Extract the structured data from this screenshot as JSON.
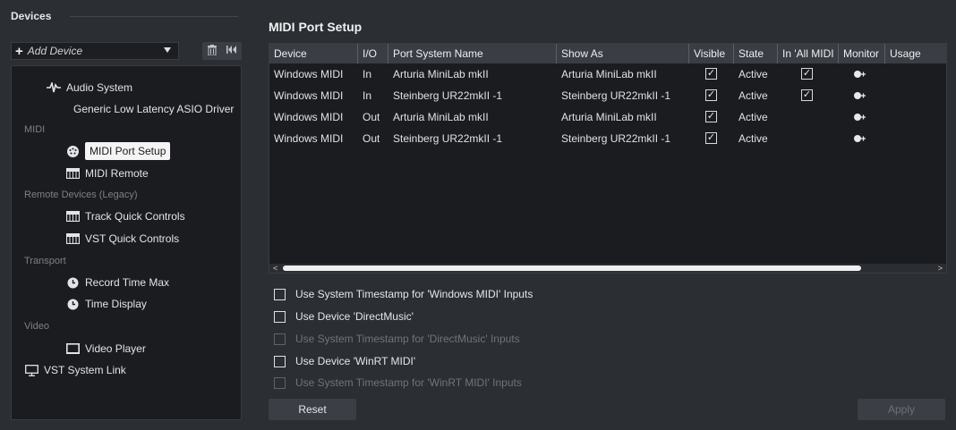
{
  "left": {
    "title": "Devices",
    "add_device_label": "Add Device",
    "tree": [
      {
        "kind": "item",
        "label": "Audio System",
        "icon": "audio-system-icon",
        "level": 1
      },
      {
        "kind": "item",
        "label": "Generic Low Latency ASIO Driver",
        "icon": "",
        "level": 2
      },
      {
        "kind": "category",
        "label": "MIDI"
      },
      {
        "kind": "item",
        "label": "MIDI Port Setup",
        "icon": "midi-port-icon",
        "level": 2,
        "selected": true
      },
      {
        "kind": "item",
        "label": "MIDI Remote",
        "icon": "keyboard-icon",
        "level": 2
      },
      {
        "kind": "category",
        "label": "Remote Devices (Legacy)"
      },
      {
        "kind": "item",
        "label": "Track Quick Controls",
        "icon": "keyboard-icon",
        "level": 2
      },
      {
        "kind": "item",
        "label": "VST Quick Controls",
        "icon": "keyboard-icon",
        "level": 2
      },
      {
        "kind": "category",
        "label": "Transport"
      },
      {
        "kind": "item",
        "label": "Record Time Max",
        "icon": "clock-icon",
        "level": 2
      },
      {
        "kind": "item",
        "label": "Time Display",
        "icon": "clock-icon",
        "level": 2
      },
      {
        "kind": "category",
        "label": "Video"
      },
      {
        "kind": "item",
        "label": "Video Player",
        "icon": "video-icon",
        "level": 2
      },
      {
        "kind": "item",
        "label": "VST System Link",
        "icon": "monitor-icon",
        "level": 0
      }
    ]
  },
  "main": {
    "title": "MIDI Port Setup",
    "columns": [
      "Device",
      "I/O",
      "Port System Name",
      "Show As",
      "Visible",
      "State",
      "In 'All MIDI Inputs'",
      "Monitor",
      "Usage"
    ],
    "rows": [
      {
        "device": "Windows MIDI",
        "io": "In",
        "port": "Arturia MiniLab mkII",
        "show_as": "Arturia MiniLab mkII",
        "visible": true,
        "state": "Active",
        "in_all": true,
        "monitor": true
      },
      {
        "device": "Windows MIDI",
        "io": "In",
        "port": "Steinberg UR22mkII -1",
        "show_as": "Steinberg UR22mkII -1",
        "visible": true,
        "state": "Active",
        "in_all": true,
        "monitor": true
      },
      {
        "device": "Windows MIDI",
        "io": "Out",
        "port": "Arturia MiniLab mkII",
        "show_as": "Arturia MiniLab mkII",
        "visible": true,
        "state": "Active",
        "in_all": false,
        "monitor": true
      },
      {
        "device": "Windows MIDI",
        "io": "Out",
        "port": "Steinberg UR22mkII -1",
        "show_as": "Steinberg UR22mkII -1",
        "visible": true,
        "state": "Active",
        "in_all": false,
        "monitor": true
      }
    ],
    "options": [
      {
        "label": "Use System Timestamp for 'Windows MIDI' Inputs",
        "enabled": true,
        "checked": false
      },
      {
        "label": "Use Device 'DirectMusic'",
        "enabled": true,
        "checked": false
      },
      {
        "label": "Use System Timestamp for 'DirectMusic' Inputs",
        "enabled": false,
        "checked": false
      },
      {
        "label": "Use Device 'WinRT MIDI'",
        "enabled": true,
        "checked": false
      },
      {
        "label": "Use System Timestamp for 'WinRT MIDI' Inputs",
        "enabled": false,
        "checked": false
      }
    ],
    "reset_label": "Reset",
    "apply_label": "Apply"
  }
}
